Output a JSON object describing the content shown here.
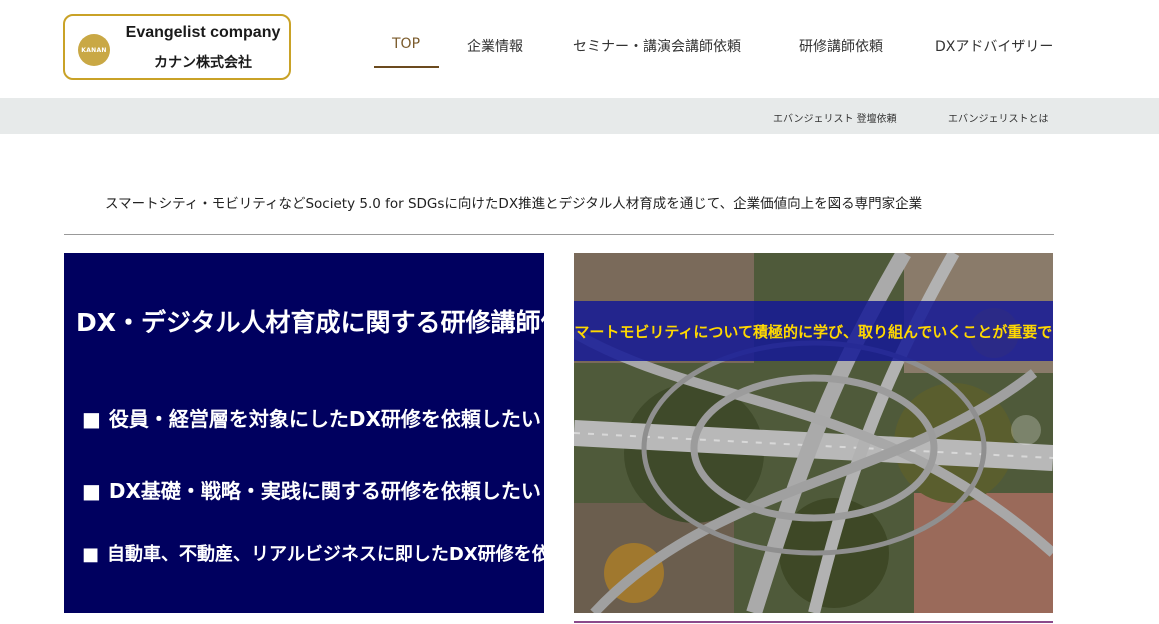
{
  "logo": {
    "badge": "KANAN",
    "name_en": "Evangelist company",
    "name_jp": "カナン株式会社"
  },
  "nav": {
    "items": [
      {
        "label": "TOP",
        "active": true
      },
      {
        "label": "企業情報"
      },
      {
        "label": "セミナー・講演会講師依頼"
      },
      {
        "label": "研修講師依頼"
      },
      {
        "label": "DXアドバイザリー"
      }
    ]
  },
  "subnav": {
    "items": [
      {
        "label": "エバンジェリスト 登壇依頼"
      },
      {
        "label": "エバンジェリストとは"
      }
    ]
  },
  "tagline": "スマートシティ・モビリティなどSociety 5.0 for SDGsに向けたDX推進とデジタル人材育成を通じて、企業価値向上を図る専門家企業",
  "left_panel": {
    "title": "DX・デジタル人材育成に関する研修講師依頼",
    "bullet": "■",
    "items": [
      "役員・経営層を対象にしたDX研修を依頼したい",
      "DX基礎・戦略・実践に関する研修を依頼したい",
      "自動車、不動産、リアルビジネスに即したDX研修を依頼したい"
    ]
  },
  "right_panel": {
    "banner": "スマートモビリティについて積極的に学び、取り組んでいくことが重要です"
  },
  "colors": {
    "accent_gold": "#c9a227",
    "panel_navy": "#00005f",
    "banner_text": "#ffd800",
    "subbar_bg": "#e7eaea"
  }
}
